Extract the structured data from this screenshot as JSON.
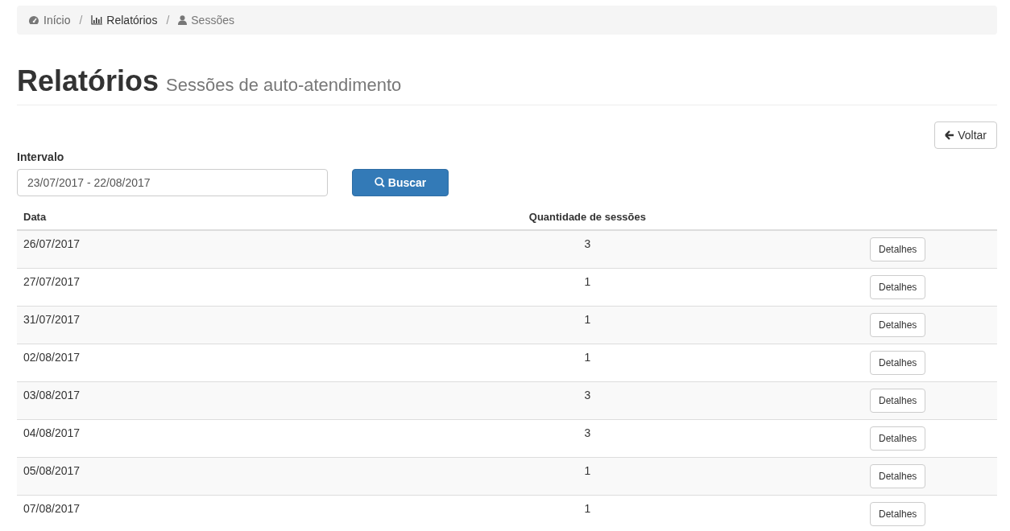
{
  "breadcrumb": [
    {
      "label": "Início",
      "current": false
    },
    {
      "separator": "/",
      "label": "Relatórios",
      "current": false
    },
    {
      "separator": "/",
      "label": "Sessões",
      "current": true
    }
  ],
  "page_header": {
    "title": "Relatórios",
    "subtitle": "Sessões de auto-atendimento"
  },
  "back_button": {
    "label": "Voltar"
  },
  "filter": {
    "label": "Intervalo",
    "value": "23/07/2017 - 22/08/2017",
    "button": "Buscar"
  },
  "table": {
    "columns": [
      "Data",
      "Quantidade de sessões"
    ],
    "rows": [
      {
        "date": "26/07/2017",
        "count": "3",
        "action": "Detalhes"
      },
      {
        "date": "27/07/2017",
        "count": "1",
        "action": "Detalhes"
      },
      {
        "date": "31/07/2017",
        "count": "1",
        "action": "Detalhes"
      },
      {
        "date": "02/08/2017",
        "count": "1",
        "action": "Detalhes"
      },
      {
        "date": "03/08/2017",
        "count": "3",
        "action": "Detalhes"
      },
      {
        "date": "04/08/2017",
        "count": "3",
        "action": "Detalhes"
      },
      {
        "date": "05/08/2017",
        "count": "1",
        "action": "Detalhes"
      },
      {
        "date": "07/08/2017",
        "count": "1",
        "action": "Detalhes"
      }
    ]
  }
}
